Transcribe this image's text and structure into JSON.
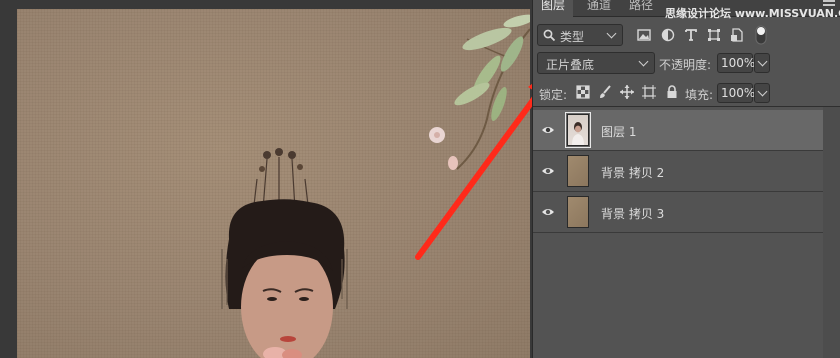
{
  "panel": {
    "tabs": [
      {
        "label": "图层",
        "active": true
      },
      {
        "label": "通道",
        "active": false
      },
      {
        "label": "路径",
        "active": false
      }
    ],
    "watermark": "思缘设计论坛 www.MISSVUAN.COM",
    "filter": {
      "label": "类型"
    },
    "blend_mode": "正片叠底",
    "opacity_label": "不透明度:",
    "opacity_value": "100%",
    "lock_label": "锁定:",
    "fill_label": "填充:",
    "fill_value": "100%",
    "layers": [
      {
        "name": "图层 1",
        "selected": true,
        "visible": true
      },
      {
        "name": "背景 拷贝 2",
        "selected": false,
        "visible": true
      },
      {
        "name": "背景 拷贝 3",
        "selected": false,
        "visible": true
      }
    ]
  },
  "colors": {
    "panel_bg": "#535353",
    "selected_layer": "#686868",
    "annotation_arrow": "#ff2a1a",
    "canvas_paper": "#9a8571"
  },
  "icons": [
    "search-icon",
    "image-filter-icon",
    "adjustment-filter-icon",
    "type-filter-icon",
    "shape-filter-icon",
    "smart-object-filter-icon",
    "toggle-filter-icon",
    "lock-pixels-icon",
    "lock-brush-icon",
    "lock-position-icon",
    "lock-artboard-icon",
    "lock-all-icon",
    "eye-icon",
    "panel-menu-icon"
  ]
}
